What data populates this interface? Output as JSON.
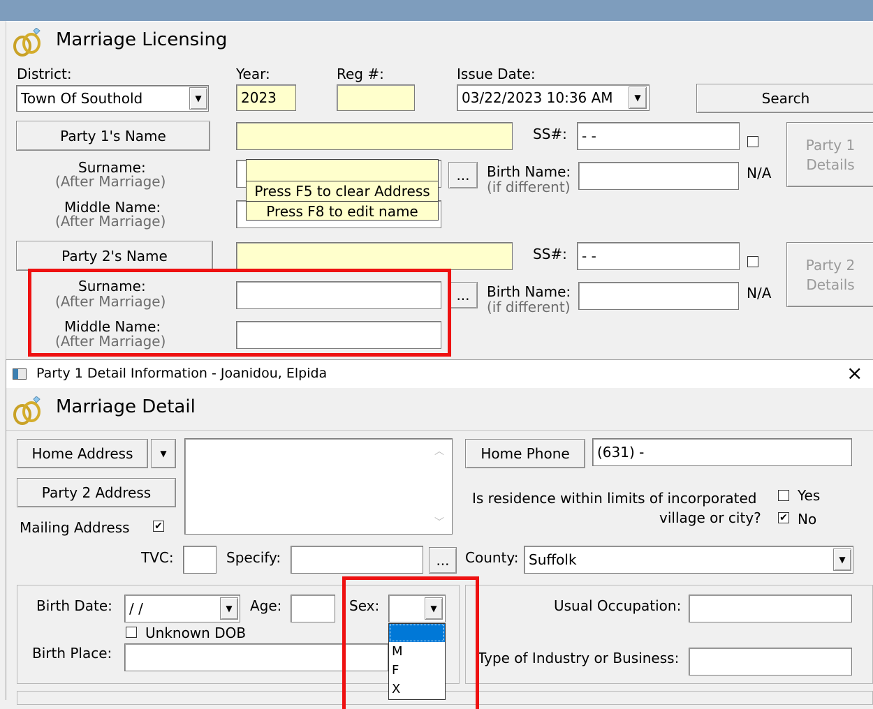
{
  "licensing": {
    "title": "Marriage Licensing",
    "district_label": "District:",
    "district_value": "Town Of Southold",
    "year_label": "Year:",
    "year_value": "2023",
    "reg_label": "Reg #:",
    "reg_value": "",
    "issue_date_label": "Issue Date:",
    "issue_date_value": "03/22/2023 10:36 AM",
    "search_button": "Search",
    "party1_name_button": "Party 1's Name",
    "party2_name_button": "Party 2's Name",
    "ss_label": "SS#:",
    "ss_value": " -  -",
    "surname_label": "Surname:",
    "after_marriage": "(After Marriage)",
    "middle_name_label": "Middle Name:",
    "ellipsis": "...",
    "birth_name_label": "Birth Name:",
    "if_different": "(if different)",
    "na_label": "N/A",
    "party1_details": "Party 1 Details",
    "party2_details": "Party 2 Details",
    "tooltip_line1": "Press F5 to clear Address",
    "tooltip_line2": "Press F8 to edit name"
  },
  "detail_window": {
    "window_title": "Party 1 Detail Information - Joanidou, Elpida",
    "close_glyph": "×",
    "header_title": "Marriage Detail",
    "home_address_button": "Home Address",
    "party2_address_button": "Party 2 Address",
    "mailing_address_label": "Mailing Address",
    "mailing_checked": true,
    "home_phone_button": "Home Phone",
    "home_phone_value": "(631)   -",
    "residence_question_line1": "Is residence within limits of incorporated",
    "residence_question_line2": "village or city?",
    "yes_label": "Yes",
    "no_label": "No",
    "tvc_label": "TVC:",
    "specify_label": "Specify:",
    "ellipsis": "...",
    "county_label": "County:",
    "county_value": "Suffolk",
    "birth_date_label": "Birth Date:",
    "birth_date_value": " /  /",
    "age_label": "Age:",
    "sex_label": "Sex:",
    "unknown_dob_label": "Unknown DOB",
    "birth_place_label": "Birth Place:",
    "usual_occupation_label": "Usual Occupation:",
    "industry_label": "Type of Industry or Business:",
    "sex_options": [
      "",
      "M",
      "F",
      "X"
    ]
  },
  "colors": {
    "highlight_red": "#ee1111",
    "field_yellow": "#ffffcc",
    "selection_blue": "#0078d7",
    "top_bar": "#7e9dbd"
  }
}
